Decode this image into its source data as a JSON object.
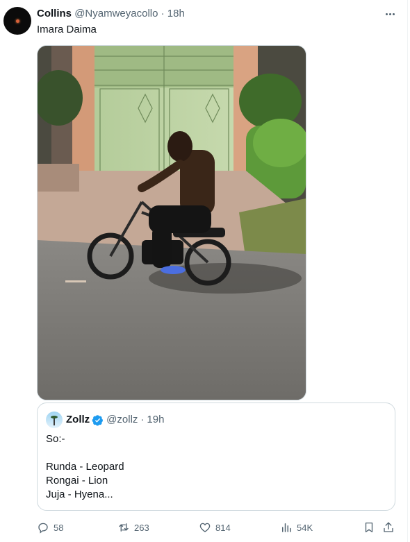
{
  "post": {
    "author_name": "Collins",
    "handle": "@Nyamweyacollo",
    "separator": "·",
    "time": "18h",
    "text": "Imara Daima",
    "media_description": "photo"
  },
  "quote": {
    "author_name": "Zollz",
    "handle": "@zollz",
    "separator": "·",
    "time": "19h",
    "lines": [
      "So:-",
      "",
      "Runda - Leopard",
      "Rongai - Lion",
      "Juja - Hyena..."
    ]
  },
  "actions": {
    "replies": "58",
    "reposts": "263",
    "likes": "814",
    "views": "54K"
  },
  "colors": {
    "text_primary": "#0f1419",
    "text_secondary": "#536471",
    "border": "#cfd9de",
    "verified": "#1d9bf0"
  }
}
